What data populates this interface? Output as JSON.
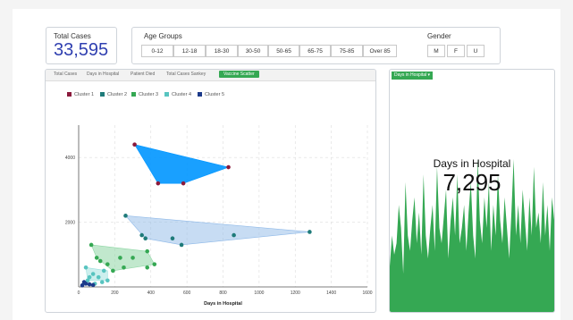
{
  "total_cases": {
    "label": "Total Cases",
    "value": "33,595"
  },
  "age_groups": {
    "label": "Age Groups",
    "options": [
      "0-12",
      "12-18",
      "18-30",
      "30-50",
      "50-65",
      "65-75",
      "75-85",
      "Over 85"
    ]
  },
  "gender": {
    "label": "Gender",
    "options": [
      "M",
      "F",
      "U"
    ]
  },
  "tabs": [
    {
      "label": "Total Cases",
      "active": false
    },
    {
      "label": "Days in Hospital",
      "active": false
    },
    {
      "label": "Patient Died",
      "active": false
    },
    {
      "label": "Total Cases Sankey",
      "active": false
    },
    {
      "label": "Vaccine Scatter",
      "active": true
    }
  ],
  "colors": {
    "cluster1": "#8b1a3c",
    "cluster2": "#1f7b7a",
    "cluster3": "#35a853",
    "cluster4": "#58c4c0",
    "cluster5": "#1c3a8a",
    "accent": "#35a853",
    "brand": "#2f3fb0"
  },
  "chart_data": {
    "type": "scatter",
    "xlabel": "Days in Hospital",
    "ylabel": "",
    "xlim": [
      0,
      1600
    ],
    "ylim": [
      0,
      5000
    ],
    "x_ticks": [
      0,
      200,
      400,
      600,
      800,
      1000,
      1200,
      1400,
      1600
    ],
    "y_ticks": [
      2000,
      4000
    ],
    "grid": true,
    "legend": "top-left",
    "series": [
      {
        "name": "Cluster 1",
        "color": "#8b1a3c",
        "points": [
          [
            310,
            4400
          ],
          [
            440,
            3200
          ],
          [
            580,
            3200
          ],
          [
            830,
            3700
          ]
        ]
      },
      {
        "name": "Cluster 2",
        "color": "#1f7b7a",
        "points": [
          [
            260,
            2200
          ],
          [
            350,
            1600
          ],
          [
            370,
            1500
          ],
          [
            520,
            1500
          ],
          [
            570,
            1300
          ],
          [
            860,
            1600
          ],
          [
            1280,
            1700
          ]
        ]
      },
      {
        "name": "Cluster 3",
        "color": "#35a853",
        "points": [
          [
            70,
            1300
          ],
          [
            100,
            900
          ],
          [
            120,
            800
          ],
          [
            160,
            700
          ],
          [
            230,
            900
          ],
          [
            250,
            600
          ],
          [
            300,
            900
          ],
          [
            380,
            1100
          ],
          [
            420,
            700
          ],
          [
            380,
            600
          ],
          [
            190,
            500
          ]
        ]
      },
      {
        "name": "Cluster 4",
        "color": "#58c4c0",
        "points": [
          [
            40,
            600
          ],
          [
            60,
            300
          ],
          [
            80,
            400
          ],
          [
            110,
            300
          ],
          [
            140,
            500
          ],
          [
            160,
            200
          ],
          [
            50,
            200
          ],
          [
            130,
            150
          ],
          [
            90,
            100
          ]
        ]
      },
      {
        "name": "Cluster 5",
        "color": "#1c3a8a",
        "points": [
          [
            20,
            50
          ],
          [
            40,
            100
          ],
          [
            60,
            80
          ],
          [
            30,
            150
          ],
          [
            80,
            60
          ]
        ]
      }
    ],
    "hulls": [
      {
        "color": "#0096ff",
        "opacity": 0.9,
        "points": [
          [
            310,
            4400
          ],
          [
            830,
            3700
          ],
          [
            580,
            3200
          ],
          [
            440,
            3200
          ]
        ]
      },
      {
        "color": "#8fb9e8",
        "opacity": 0.5,
        "points": [
          [
            260,
            2200
          ],
          [
            1280,
            1700
          ],
          [
            570,
            1300
          ],
          [
            370,
            1500
          ]
        ]
      },
      {
        "color": "#8ed6a4",
        "opacity": 0.55,
        "points": [
          [
            70,
            1300
          ],
          [
            380,
            1100
          ],
          [
            420,
            700
          ],
          [
            190,
            500
          ],
          [
            100,
            900
          ]
        ]
      },
      {
        "color": "#9be0dd",
        "opacity": 0.5,
        "points": [
          [
            40,
            600
          ],
          [
            160,
            500
          ],
          [
            160,
            200
          ],
          [
            50,
            200
          ]
        ]
      }
    ]
  },
  "right_panel": {
    "dropdown": "Days in Hospital",
    "title": "Days in Hospital",
    "value": "7,295",
    "area_color": "#35a853",
    "area_values": [
      12,
      20,
      15,
      18,
      28,
      22,
      10,
      34,
      20,
      16,
      24,
      30,
      18,
      26,
      15,
      36,
      20,
      14,
      22,
      28,
      16,
      38,
      22,
      18,
      25,
      32,
      14,
      24,
      30,
      20,
      36,
      18,
      22,
      28,
      16,
      26,
      34,
      20,
      14,
      40,
      24,
      18,
      30,
      22,
      34,
      16,
      28,
      20,
      36,
      24,
      18,
      30,
      22,
      14,
      26,
      40,
      20,
      28,
      18,
      32,
      24,
      16,
      30,
      20,
      38,
      22,
      26,
      18,
      34,
      20,
      28,
      16,
      30,
      24
    ]
  }
}
